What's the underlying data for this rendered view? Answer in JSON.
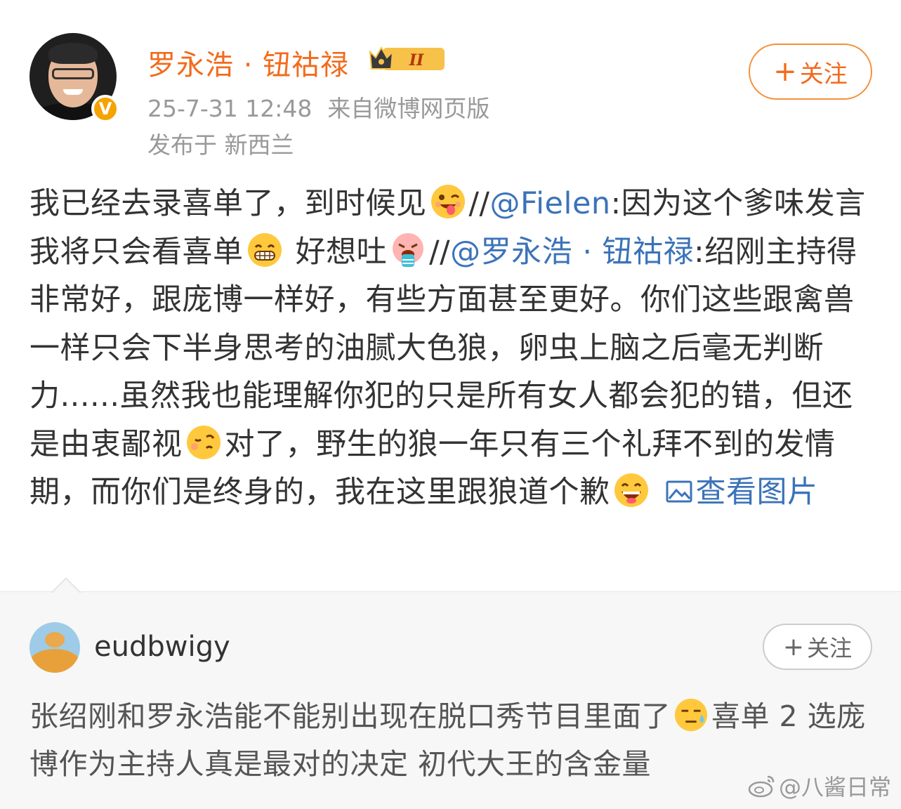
{
  "post": {
    "author": "罗永浩 · 钮祜禄",
    "level_badge": "II",
    "date": "25-7-31 12:48",
    "source": "来自微博网页版",
    "location": "发布于 新西兰",
    "follow_label": "关注",
    "body": {
      "t1": "我已经去录喜单了，到时候见",
      "sep1": "//",
      "m1": "@Fielen",
      "t2": ":因为这个爹味发言我将只会看喜单",
      "t3": " 好想吐",
      "sep2": "//",
      "m2": "@罗永浩 · 钮祜禄",
      "t4": ":绍刚主持得非常好，跟庞博一样好，有些方面甚至更好。你们这些跟禽兽一样只会下半身思考的油腻大色狼，卵虫上脑之后毫无判断力......虽然我也能理解你犯的只是所有女人都会犯的错，但还是由衷鄙视",
      "t5": "对了，野生的狼一年只有三个礼拜不到的发情期，而你们是终身的，我在这里跟狼道个歉",
      "view_images": "查看图片"
    },
    "emojis": [
      "tongue-wink-emoji",
      "grin-emoji",
      "vomit-emoji",
      "sly-emoji",
      "laugh-emoji"
    ]
  },
  "comment": {
    "username": "eudbwigy",
    "follow_label": "关注",
    "text_a": "张绍刚和罗永浩能不能别出现在脱口秀节目里面了",
    "text_b": "喜单 2 选庞博作为主持人真是最对的决定 初代大王的含金量",
    "emoji": "sweat-emoji"
  },
  "watermark": "@八酱日常",
  "colors": {
    "accent": "#f26b1c",
    "link": "#3b73b9",
    "meta": "#999999"
  }
}
